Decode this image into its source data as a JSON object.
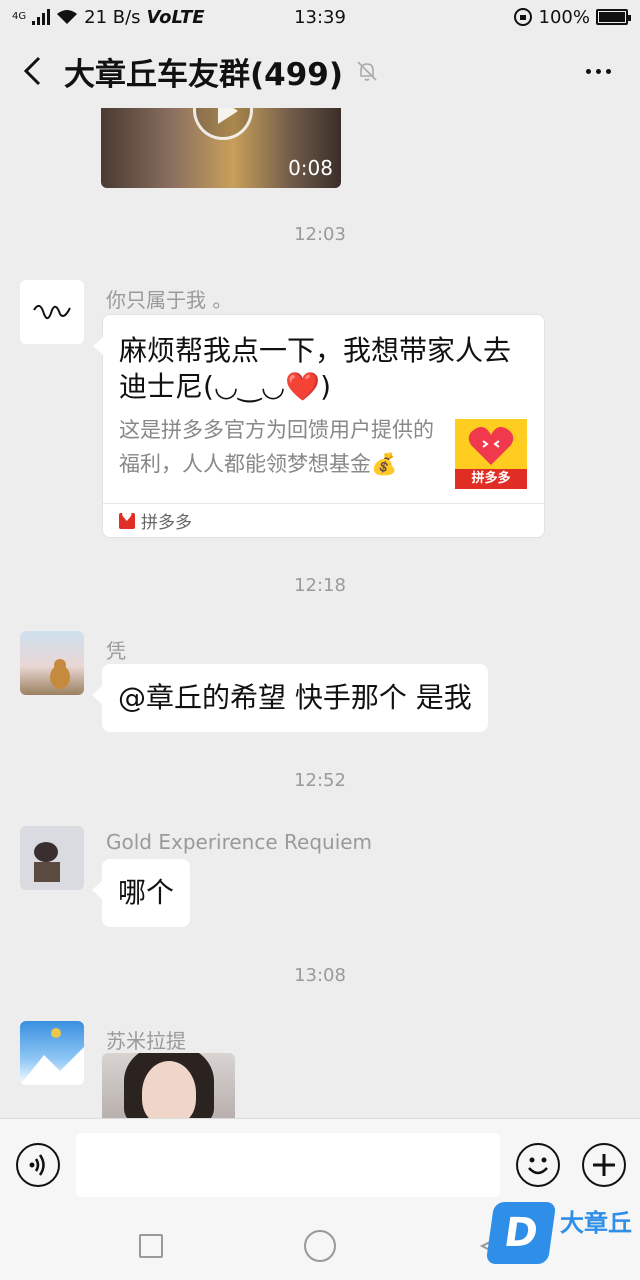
{
  "status_bar": {
    "network_label": "4G",
    "speed": "21 B/s",
    "volte": "VoLTE",
    "time": "13:39",
    "battery": "100%",
    "battery_level": 1.0
  },
  "header": {
    "title": "大章丘车友群(499)",
    "back_icon": "chevron-left-icon",
    "mute_icon": "bell-off-icon",
    "more_icon": "more-dots-icon"
  },
  "messages": {
    "video": {
      "duration": "0:08"
    },
    "ts1": "12:03",
    "msg1": {
      "nickname": "你只属于我 。",
      "card_title": "麻烦帮我点一下，我想带家人去迪士尼(◡‿◡❤️)",
      "card_desc": "这是拼多多官方为回馈用户提供的福利，人人都能领梦想基金💰",
      "card_source": "拼多多",
      "thumb_brand": "拼多多"
    },
    "ts2": "12:18",
    "msg2": {
      "nickname": "凭",
      "text": "@章丘的希望  快手那个 是我"
    },
    "ts3": "12:52",
    "msg3": {
      "nickname": "Gold Experirence Requiem",
      "text": "哪个"
    },
    "ts4": "13:08",
    "msg4": {
      "nickname": "苏米拉提"
    }
  },
  "input_bar": {
    "voice_icon": "voice-icon",
    "emoji_icon": "emoji-icon",
    "plus_icon": "plus-icon",
    "placeholder": ""
  },
  "watermark": {
    "text": "大章丘"
  },
  "colors": {
    "background": "#ededed",
    "bubble": "#ffffff",
    "accent": "#2f8fe8",
    "pdd_red": "#e02e24"
  }
}
